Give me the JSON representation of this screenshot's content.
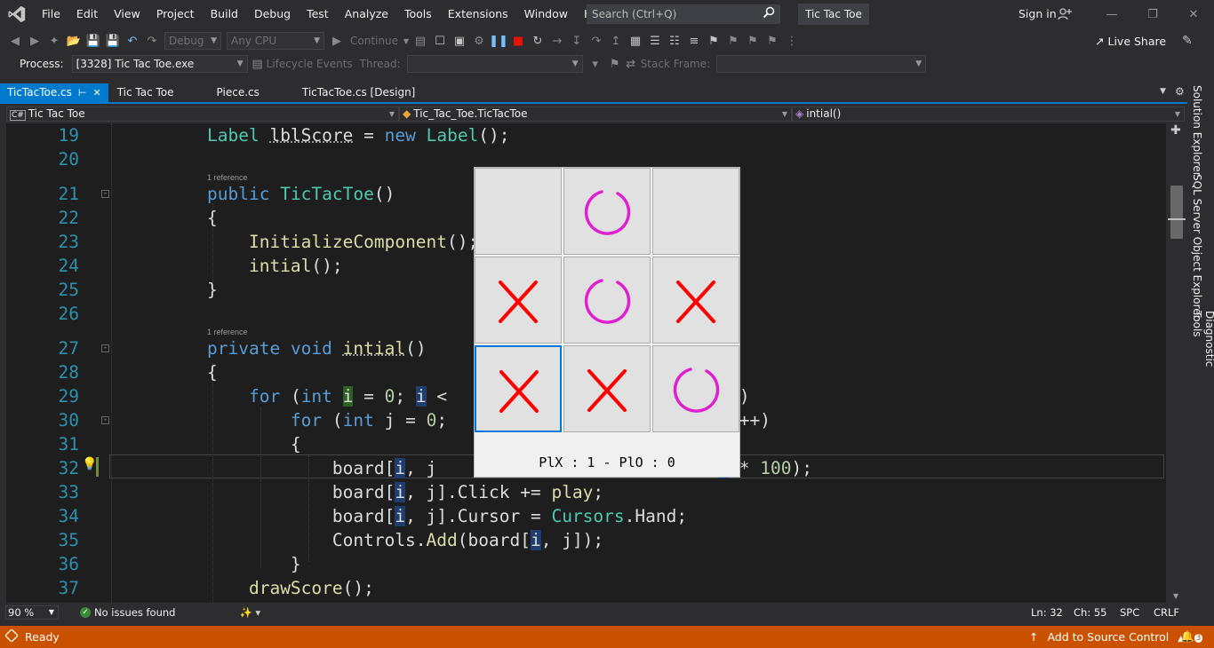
{
  "menu": [
    "File",
    "Edit",
    "View",
    "Project",
    "Build",
    "Debug",
    "Test",
    "Analyze",
    "Tools",
    "Extensions",
    "Window",
    "Help"
  ],
  "search": {
    "placeholder": "Search (Ctrl+Q)"
  },
  "solution_name": "Tic Tac Toe",
  "signin": "Sign in",
  "toolbar": {
    "config": "Debug",
    "platform": "Any CPU",
    "continue": "Continue",
    "live_share": "Live Share"
  },
  "toolbar2": {
    "process_label": "Process:",
    "process_value": "[3328] Tic Tac Toe.exe",
    "lifecycle": "Lifecycle Events",
    "thread_label": "Thread:",
    "stack_label": "Stack Frame:"
  },
  "tabs": [
    "TicTacToe.cs",
    "Tic Tac Toe",
    "Piece.cs",
    "TicTacToe.cs [Design]"
  ],
  "nav": {
    "project": "Tic Tac Toe",
    "class": "Tic_Tac_Toe.TicTacToe",
    "member": "intial()"
  },
  "code_lines": [
    {
      "n": "19"
    },
    {
      "n": "20"
    },
    {
      "n": "21"
    },
    {
      "n": "22"
    },
    {
      "n": "23"
    },
    {
      "n": "24"
    },
    {
      "n": "25"
    },
    {
      "n": "26"
    },
    {
      "n": "27"
    },
    {
      "n": "28"
    },
    {
      "n": "29"
    },
    {
      "n": "30"
    },
    {
      "n": "31"
    },
    {
      "n": "32"
    },
    {
      "n": "33"
    },
    {
      "n": "34"
    },
    {
      "n": "35"
    },
    {
      "n": "36"
    },
    {
      "n": "37"
    }
  ],
  "codelens": "1 reference",
  "game": {
    "board": [
      "",
      "O",
      "",
      "X",
      "O",
      "X",
      "X",
      "X",
      "O"
    ],
    "score_text": "PlX : 1 - PlO : 0",
    "x_color": "#ff0000",
    "o_color": "#e020d0"
  },
  "footer": {
    "zoom": "90 %",
    "issues": "No issues found",
    "ln": "Ln: 32",
    "ch": "Ch: 55",
    "spc": "SPC",
    "crlf": "CRLF"
  },
  "status": {
    "ready": "Ready",
    "source_control": "Add to Source Control",
    "notifications": "3"
  },
  "side_tabs": [
    "Solution Explorer",
    "SQL Server Object Explorer",
    "Diagnostic Tools"
  ],
  "colors": {
    "accent": "#007acc",
    "statusbar": "#ca5100"
  }
}
